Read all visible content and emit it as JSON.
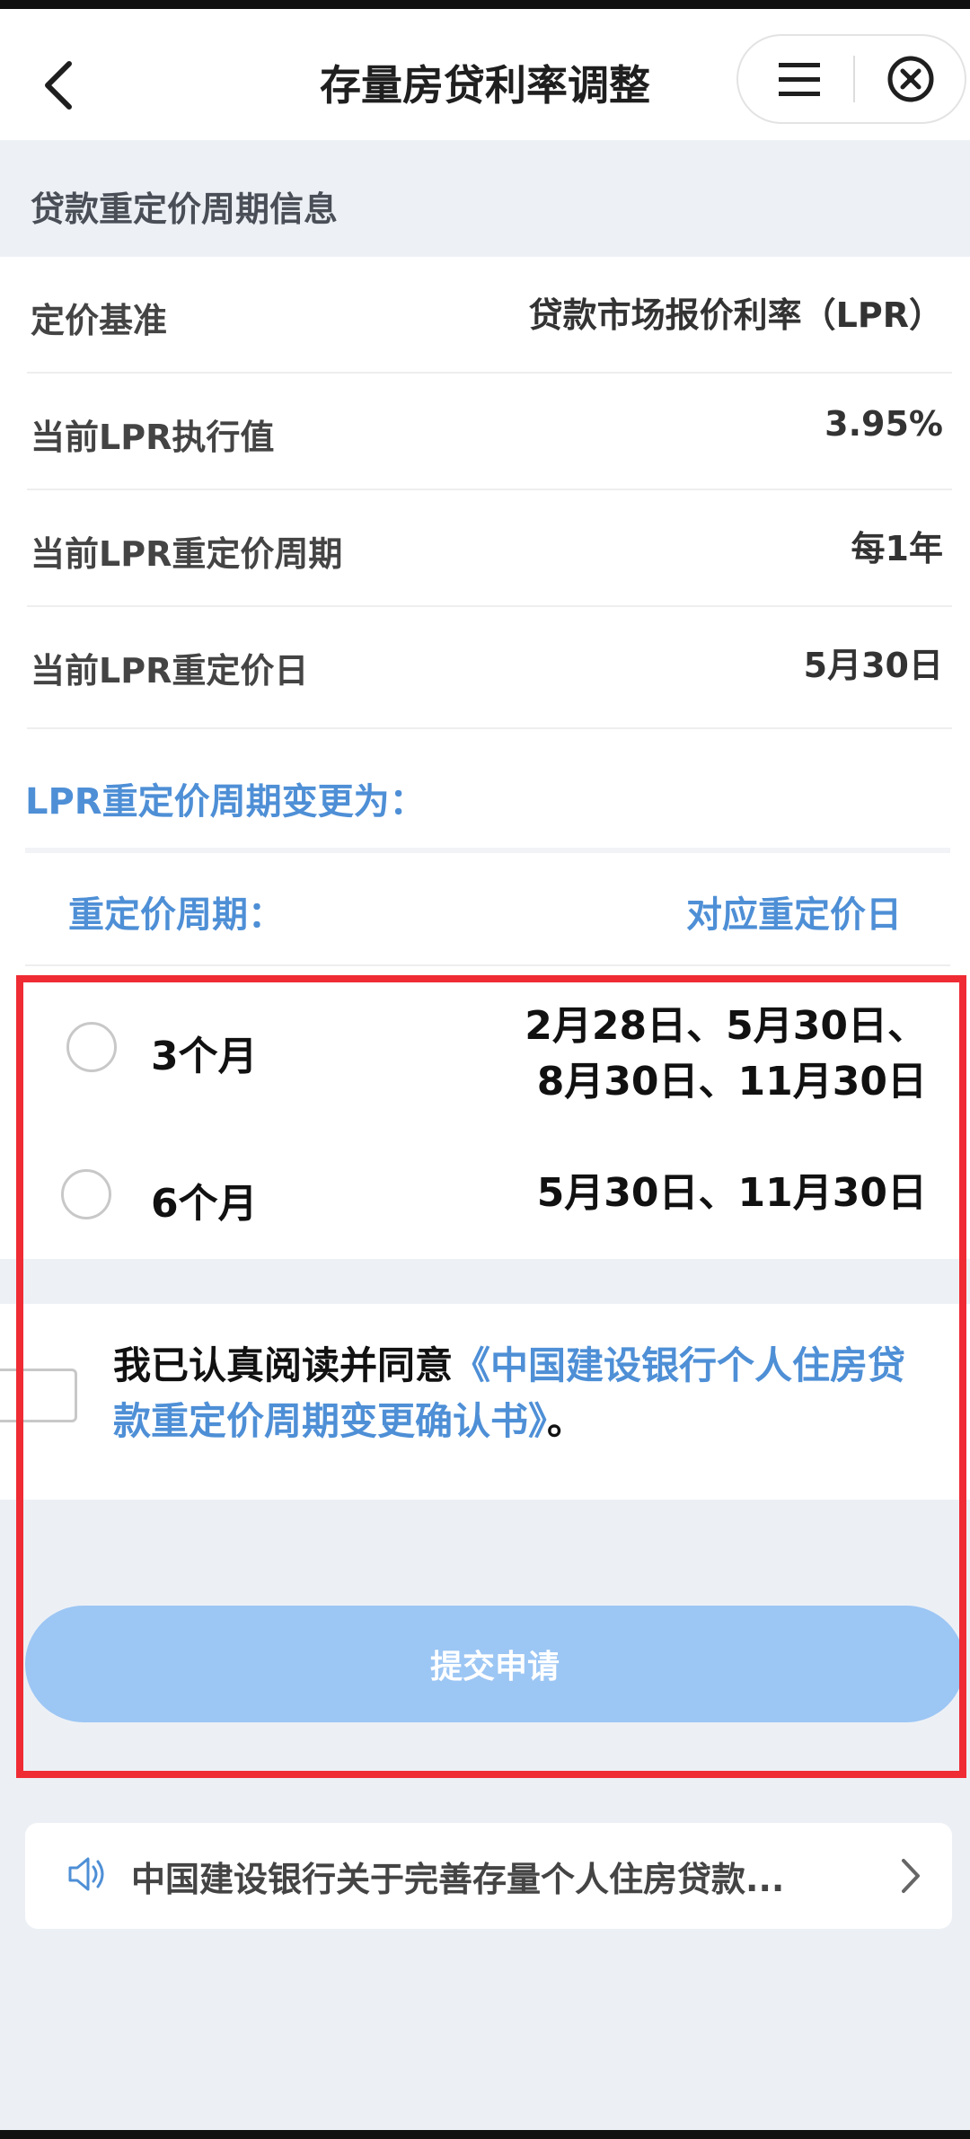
{
  "header": {
    "title": "存量房贷利率调整",
    "back_icon": "chevron-left-icon",
    "menu_icon": "menu-icon",
    "close_icon": "close-circle-icon"
  },
  "section": {
    "title": "贷款重定价周期信息"
  },
  "info": {
    "rows": [
      {
        "label": "定价基准",
        "value": "贷款市场报价利率（LPR）"
      },
      {
        "label": "当前LPR执行值",
        "value": "3.95%"
      },
      {
        "label": "当前LPR重定价周期",
        "value": "每1年"
      },
      {
        "label": "当前LPR重定价日",
        "value": "5月30日"
      }
    ]
  },
  "change": {
    "title": "LPR重定价周期变更为：",
    "col_left": "重定价周期：",
    "col_right": "对应重定价日",
    "options": [
      {
        "label": "3个月",
        "dates_line1": "2月28日、5月30日、",
        "dates_line2": "8月30日、11月30日"
      },
      {
        "label": "6个月",
        "dates_line1": "5月30日、11月30日"
      }
    ]
  },
  "agreement": {
    "text": "我已认真阅读并同意",
    "link": "《中国建设银行个人住房贷款重定价周期变更确认书》",
    "suffix": "。"
  },
  "submit": {
    "label": "提交申请"
  },
  "notice": {
    "icon": "speaker-icon",
    "text": "中国建设银行关于完善存量个人住房贷款..."
  },
  "colors": {
    "accent": "#4e8fd6",
    "button": "#9cc6f4",
    "highlight_border": "#ef2b34"
  }
}
